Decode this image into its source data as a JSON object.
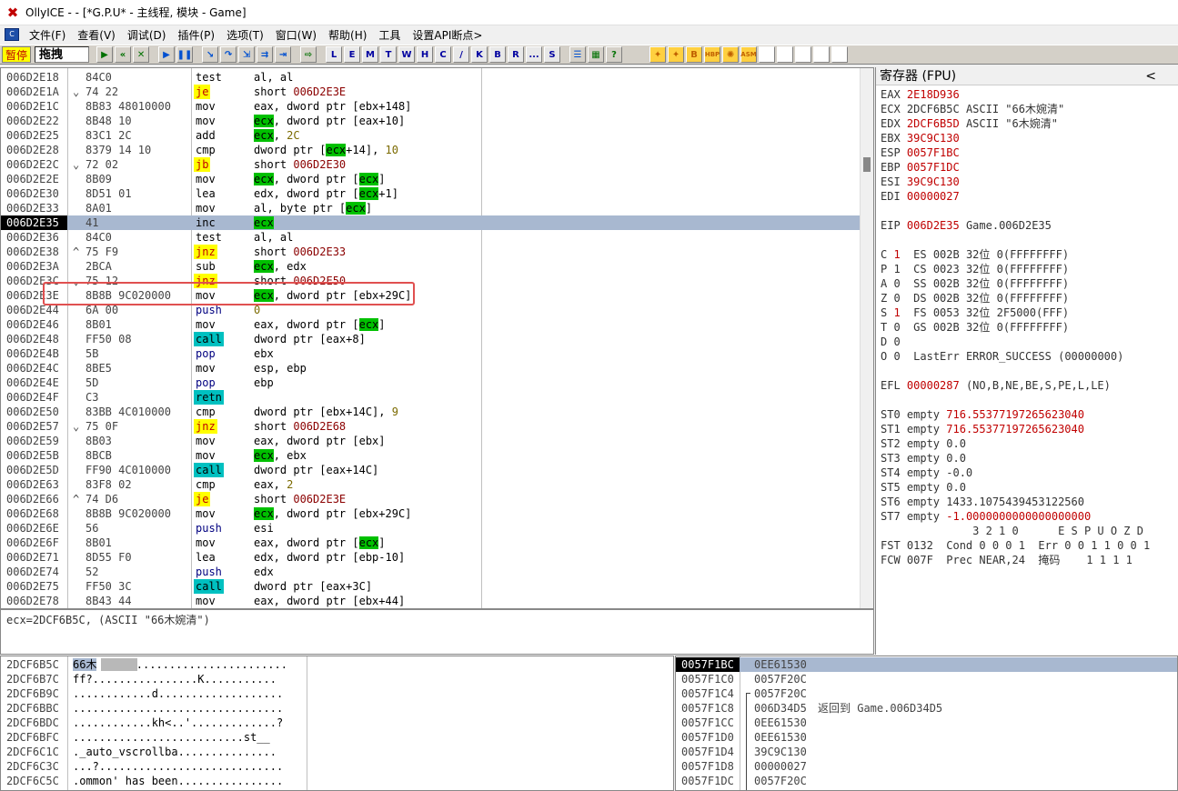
{
  "window": {
    "title": "OllyICE - - [*G.P.U* - 主线程, 模块 - Game]"
  },
  "menu": [
    "文件(F)",
    "查看(V)",
    "调试(D)",
    "插件(P)",
    "选项(T)",
    "窗口(W)",
    "帮助(H)",
    "工具",
    "设置API断点>"
  ],
  "toolbar": {
    "status": "暂停",
    "operation": "拖拽",
    "letters": [
      "L",
      "E",
      "M",
      "T",
      "W",
      "H",
      "C",
      "/",
      "K",
      "B",
      "R",
      "...",
      "S"
    ],
    "extra": [
      "HBP",
      "ASM"
    ]
  },
  "cpu": {
    "rows": [
      {
        "addr": "006D2E18",
        "m": "",
        "hex": "84C0",
        "mn": "test",
        "op": "al, al",
        "k": "n"
      },
      {
        "addr": "006D2E1A",
        "m": "⌄",
        "hex": "74 22",
        "mn": "je",
        "op": "short 006D2E3E",
        "k": "j"
      },
      {
        "addr": "006D2E1C",
        "m": "",
        "hex": "8B83 48010000",
        "mn": "mov",
        "op": "eax, dword ptr [ebx+148]",
        "k": "n"
      },
      {
        "addr": "006D2E22",
        "m": "",
        "hex": "8B48 10",
        "mn": "mov",
        "op": "ecx, dword ptr [eax+10]",
        "k": "n"
      },
      {
        "addr": "006D2E25",
        "m": "",
        "hex": "83C1 2C",
        "mn": "add",
        "op": "ecx, 2C",
        "k": "n"
      },
      {
        "addr": "006D2E28",
        "m": "",
        "hex": "8379 14 10",
        "mn": "cmp",
        "op": "dword ptr [ecx+14], 10",
        "k": "n"
      },
      {
        "addr": "006D2E2C",
        "m": "⌄",
        "hex": "72 02",
        "mn": "jb",
        "op": "short 006D2E30",
        "k": "j"
      },
      {
        "addr": "006D2E2E",
        "m": "",
        "hex": "8B09",
        "mn": "mov",
        "op": "ecx, dword ptr [ecx]",
        "k": "n"
      },
      {
        "addr": "006D2E30",
        "m": "",
        "hex": "8D51 01",
        "mn": "lea",
        "op": "edx, dword ptr [ecx+1]",
        "k": "n"
      },
      {
        "addr": "006D2E33",
        "m": "",
        "hex": "8A01",
        "mn": "mov",
        "op": "al, byte ptr [ecx]",
        "k": "n"
      },
      {
        "addr": "006D2E35",
        "m": "",
        "hex": "41",
        "mn": "inc",
        "op": "ecx",
        "k": "n"
      },
      {
        "addr": "006D2E36",
        "m": "",
        "hex": "84C0",
        "mn": "test",
        "op": "al, al",
        "k": "n"
      },
      {
        "addr": "006D2E38",
        "m": "^",
        "hex": "75 F9",
        "mn": "jnz",
        "op": "short 006D2E33",
        "k": "j"
      },
      {
        "addr": "006D2E3A",
        "m": "",
        "hex": "2BCA",
        "mn": "sub",
        "op": "ecx, edx",
        "k": "n"
      },
      {
        "addr": "006D2E3C",
        "m": "⌄",
        "hex": "75 12",
        "mn": "jnz",
        "op": "short 006D2E50",
        "k": "j"
      },
      {
        "addr": "006D2E3E",
        "m": "",
        "hex": "8B8B 9C020000",
        "mn": "mov",
        "op": "ecx, dword ptr [ebx+29C]",
        "k": "n"
      },
      {
        "addr": "006D2E44",
        "m": "",
        "hex": "6A 00",
        "mn": "push",
        "op": "0",
        "k": "p"
      },
      {
        "addr": "006D2E46",
        "m": "",
        "hex": "8B01",
        "mn": "mov",
        "op": "eax, dword ptr [ecx]",
        "k": "n"
      },
      {
        "addr": "006D2E48",
        "m": "",
        "hex": "FF50 08",
        "mn": "call",
        "op": "dword ptr [eax+8]",
        "k": "c"
      },
      {
        "addr": "006D2E4B",
        "m": "",
        "hex": "5B",
        "mn": "pop",
        "op": "ebx",
        "k": "p"
      },
      {
        "addr": "006D2E4C",
        "m": "",
        "hex": "8BE5",
        "mn": "mov",
        "op": "esp, ebp",
        "k": "n"
      },
      {
        "addr": "006D2E4E",
        "m": "",
        "hex": "5D",
        "mn": "pop",
        "op": "ebp",
        "k": "p"
      },
      {
        "addr": "006D2E4F",
        "m": "",
        "hex": "C3",
        "mn": "retn",
        "op": "",
        "k": "r"
      },
      {
        "addr": "006D2E50",
        "m": "",
        "hex": "83BB 4C010000",
        "mn": "cmp",
        "op": "dword ptr [ebx+14C], 9",
        "k": "n"
      },
      {
        "addr": "006D2E57",
        "m": "⌄",
        "hex": "75 0F",
        "mn": "jnz",
        "op": "short 006D2E68",
        "k": "j"
      },
      {
        "addr": "006D2E59",
        "m": "",
        "hex": "8B03",
        "mn": "mov",
        "op": "eax, dword ptr [ebx]",
        "k": "n"
      },
      {
        "addr": "006D2E5B",
        "m": "",
        "hex": "8BCB",
        "mn": "mov",
        "op": "ecx, ebx",
        "k": "n"
      },
      {
        "addr": "006D2E5D",
        "m": "",
        "hex": "FF90 4C010000",
        "mn": "call",
        "op": "dword ptr [eax+14C]",
        "k": "c"
      },
      {
        "addr": "006D2E63",
        "m": "",
        "hex": "83F8 02",
        "mn": "cmp",
        "op": "eax, 2",
        "k": "n"
      },
      {
        "addr": "006D2E66",
        "m": "^",
        "hex": "74 D6",
        "mn": "je",
        "op": "short 006D2E3E",
        "k": "j"
      },
      {
        "addr": "006D2E68",
        "m": "",
        "hex": "8B8B 9C020000",
        "mn": "mov",
        "op": "ecx, dword ptr [ebx+29C]",
        "k": "n"
      },
      {
        "addr": "006D2E6E",
        "m": "",
        "hex": "56",
        "mn": "push",
        "op": "esi",
        "k": "p"
      },
      {
        "addr": "006D2E6F",
        "m": "",
        "hex": "8B01",
        "mn": "mov",
        "op": "eax, dword ptr [ecx]",
        "k": "n"
      },
      {
        "addr": "006D2E71",
        "m": "",
        "hex": "8D55 F0",
        "mn": "lea",
        "op": "edx, dword ptr [ebp-10]",
        "k": "n"
      },
      {
        "addr": "006D2E74",
        "m": "",
        "hex": "52",
        "mn": "push",
        "op": "edx",
        "k": "p"
      },
      {
        "addr": "006D2E75",
        "m": "",
        "hex": "FF50 3C",
        "mn": "call",
        "op": "dword ptr [eax+3C]",
        "k": "c"
      },
      {
        "addr": "006D2E78",
        "m": "",
        "hex": "8B43 44",
        "mn": "mov",
        "op": "eax, dword ptr [ebx+44]",
        "k": "n"
      }
    ],
    "info": "ecx=2DCF6B5C, (ASCII \"66木婉清\")"
  },
  "registers": {
    "header": "寄存器 (FPU)",
    "lines": [
      {
        "k": "EAX",
        "v": "2E18D936",
        "x": ""
      },
      {
        "k": "ECX",
        "v": "2DCF6B5C",
        "x": " ASCII \"66木婉清\"",
        "plain": true
      },
      {
        "k": "EDX",
        "v": "2DCF6B5D",
        "x": " ASCII \"6木婉清\""
      },
      {
        "k": "EBX",
        "v": "39C9C130",
        "x": ""
      },
      {
        "k": "ESP",
        "v": "0057F1BC",
        "x": ""
      },
      {
        "k": "EBP",
        "v": "0057F1DC",
        "x": ""
      },
      {
        "k": "ESI",
        "v": "39C9C130",
        "x": ""
      },
      {
        "k": "EDI",
        "v": "00000027",
        "x": ""
      },
      {
        "k": "",
        "v": "",
        "x": ""
      },
      {
        "k": "EIP",
        "v": "006D2E35",
        "x": " Game.006D2E35"
      },
      {
        "k": "",
        "v": "",
        "x": ""
      },
      {
        "k": "C",
        "v": "1",
        "x": "  ES 002B 32位 0(FFFFFFFF)"
      },
      {
        "k": "P",
        "v": "1",
        "x": "  CS 0023 32位 0(FFFFFFFF)",
        "plain": true
      },
      {
        "k": "A",
        "v": "0",
        "x": "  SS 002B 32位 0(FFFFFFFF)",
        "plain": true
      },
      {
        "k": "Z",
        "v": "0",
        "x": "  DS 002B 32位 0(FFFFFFFF)",
        "plain": true
      },
      {
        "k": "S",
        "v": "1",
        "x": "  FS 0053 32位 2F5000(FFF)"
      },
      {
        "k": "T",
        "v": "0",
        "x": "  GS 002B 32位 0(FFFFFFFF)",
        "plain": true
      },
      {
        "k": "D",
        "v": "0",
        "x": "",
        "plain": true
      },
      {
        "k": "O",
        "v": "0",
        "x": "  LastErr ERROR_SUCCESS (00000000)",
        "plain": true
      },
      {
        "k": "",
        "v": "",
        "x": ""
      },
      {
        "k": "EFL",
        "v": "00000287",
        "x": " (NO,B,NE,BE,S,PE,L,LE)"
      },
      {
        "k": "",
        "v": "",
        "x": ""
      },
      {
        "k": "ST0",
        "v": "",
        "x": " empty ",
        "r": "716.55377197265623040"
      },
      {
        "k": "ST1",
        "v": "",
        "x": " empty ",
        "r": "716.55377197265623040"
      },
      {
        "k": "ST2",
        "v": "",
        "x": " empty 0.0"
      },
      {
        "k": "ST3",
        "v": "",
        "x": " empty 0.0"
      },
      {
        "k": "ST4",
        "v": "",
        "x": " empty -0.0"
      },
      {
        "k": "ST5",
        "v": "",
        "x": " empty 0.0"
      },
      {
        "k": "ST6",
        "v": "",
        "x": " empty 1433.1075439453122560"
      },
      {
        "k": "ST7",
        "v": "",
        "x": " empty ",
        "r": "-1.0000000000000000000"
      },
      {
        "k": "",
        "v": "",
        "x": "              3 2 1 0      E S P U O Z D"
      },
      {
        "k": "FST",
        "v": "",
        "x": " 0132  Cond 0 0 0 1  Err 0 0 1 1 0 0 1"
      },
      {
        "k": "FCW",
        "v": "",
        "x": " 007F  Prec NEAR,24  掩码    1 1 1 1"
      }
    ]
  },
  "dump": {
    "rows": [
      {
        "a": "2DCF6B5C",
        "t": "66木",
        "u": "  ..........................."
      },
      {
        "a": "2DCF6B7C",
        "t": "ff?................K...........",
        "u": ""
      },
      {
        "a": "2DCF6B9C",
        "t": "............d...................",
        "u": ""
      },
      {
        "a": "2DCF6BBC",
        "t": "................................",
        "u": ""
      },
      {
        "a": "2DCF6BDC",
        "t": "............kh<..'.............?",
        "u": ""
      },
      {
        "a": "2DCF6BFC",
        "t": "..........................st__",
        "u": ""
      },
      {
        "a": "2DCF6C1C",
        "t": "._auto_vscrollba...............",
        "u": ""
      },
      {
        "a": "2DCF6C3C",
        "t": "...?............................",
        "u": ""
      },
      {
        "a": "2DCF6C5C",
        "t": ".ommon' has been................",
        "u": ""
      }
    ]
  },
  "stack": {
    "rows": [
      {
        "a": "0057F1BC",
        "v": "0EE61530",
        "c": ""
      },
      {
        "a": "0057F1C0",
        "v": "0057F20C",
        "c": ""
      },
      {
        "a": "0057F1C4",
        "v": "0057F20C",
        "c": ""
      },
      {
        "a": "0057F1C8",
        "v": "006D34D5",
        "c": "返回到 Game.006D34D5"
      },
      {
        "a": "0057F1CC",
        "v": "0EE61530",
        "c": ""
      },
      {
        "a": "0057F1D0",
        "v": "0EE61530",
        "c": ""
      },
      {
        "a": "0057F1D4",
        "v": "39C9C130",
        "c": ""
      },
      {
        "a": "0057F1D8",
        "v": "00000027",
        "c": ""
      },
      {
        "a": "0057F1DC",
        "v": "0057F20C",
        "c": ""
      }
    ]
  },
  "colors": {
    "selection": "#a8b8d0",
    "jump": "#ffff00",
    "call": "#00c0c0",
    "reg": "#00c000",
    "value": "#c00000"
  }
}
